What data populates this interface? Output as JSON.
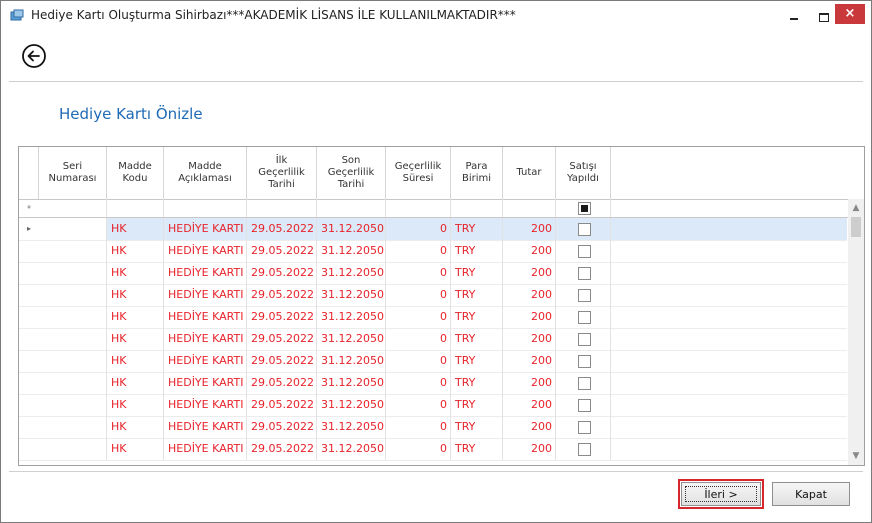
{
  "window": {
    "title": "Hediye Kartı Oluşturma Sihirbazı***AKADEMİK LİSANS İLE KULLANILMAKTADIR***",
    "close_label": "×"
  },
  "page": {
    "title": "Hediye Kartı Önizle"
  },
  "grid": {
    "columns": [
      [
        "Seri",
        "Numarası"
      ],
      [
        "Madde",
        "Kodu"
      ],
      [
        "Madde",
        "Açıklaması"
      ],
      [
        "İlk",
        "Geçerlilik",
        "Tarihi"
      ],
      [
        "Son",
        "Geçerlilik",
        "Tarihi"
      ],
      [
        "Geçerlilik",
        "Süresi"
      ],
      [
        "Para",
        "Birimi"
      ],
      [
        "Tutar"
      ],
      [
        "Satışı",
        "Yapıldı"
      ]
    ],
    "filter_indicator": "ᵩ",
    "row_indicator": "▸",
    "rows": [
      {
        "seri": "",
        "kod": "HK",
        "aciklama": "HEDİYE KARTI",
        "ilk": "29.05.2022",
        "son": "31.12.2050",
        "sure": "0",
        "para": "TRY",
        "tutar": "200",
        "satis": false
      },
      {
        "seri": "",
        "kod": "HK",
        "aciklama": "HEDİYE KARTI",
        "ilk": "29.05.2022",
        "son": "31.12.2050",
        "sure": "0",
        "para": "TRY",
        "tutar": "200",
        "satis": false
      },
      {
        "seri": "",
        "kod": "HK",
        "aciklama": "HEDİYE KARTI",
        "ilk": "29.05.2022",
        "son": "31.12.2050",
        "sure": "0",
        "para": "TRY",
        "tutar": "200",
        "satis": false
      },
      {
        "seri": "",
        "kod": "HK",
        "aciklama": "HEDİYE KARTI",
        "ilk": "29.05.2022",
        "son": "31.12.2050",
        "sure": "0",
        "para": "TRY",
        "tutar": "200",
        "satis": false
      },
      {
        "seri": "",
        "kod": "HK",
        "aciklama": "HEDİYE KARTI",
        "ilk": "29.05.2022",
        "son": "31.12.2050",
        "sure": "0",
        "para": "TRY",
        "tutar": "200",
        "satis": false
      },
      {
        "seri": "",
        "kod": "HK",
        "aciklama": "HEDİYE KARTI",
        "ilk": "29.05.2022",
        "son": "31.12.2050",
        "sure": "0",
        "para": "TRY",
        "tutar": "200",
        "satis": false
      },
      {
        "seri": "",
        "kod": "HK",
        "aciklama": "HEDİYE KARTI",
        "ilk": "29.05.2022",
        "son": "31.12.2050",
        "sure": "0",
        "para": "TRY",
        "tutar": "200",
        "satis": false
      },
      {
        "seri": "",
        "kod": "HK",
        "aciklama": "HEDİYE KARTI",
        "ilk": "29.05.2022",
        "son": "31.12.2050",
        "sure": "0",
        "para": "TRY",
        "tutar": "200",
        "satis": false
      },
      {
        "seri": "",
        "kod": "HK",
        "aciklama": "HEDİYE KARTI",
        "ilk": "29.05.2022",
        "son": "31.12.2050",
        "sure": "0",
        "para": "TRY",
        "tutar": "200",
        "satis": false
      },
      {
        "seri": "",
        "kod": "HK",
        "aciklama": "HEDİYE KARTI",
        "ilk": "29.05.2022",
        "son": "31.12.2050",
        "sure": "0",
        "para": "TRY",
        "tutar": "200",
        "satis": false
      },
      {
        "seri": "",
        "kod": "HK",
        "aciklama": "HEDİYE KARTI",
        "ilk": "29.05.2022",
        "son": "31.12.2050",
        "sure": "0",
        "para": "TRY",
        "tutar": "200",
        "satis": false
      }
    ],
    "scroll_up": "▲",
    "scroll_down": "▼"
  },
  "buttons": {
    "next": "İleri >",
    "close": "Kapat"
  },
  "colors": {
    "title_blue": "#1e6ab5",
    "row_text_red": "#e8232b",
    "highlight_red": "#d6252b",
    "close_red": "#c9393b"
  }
}
